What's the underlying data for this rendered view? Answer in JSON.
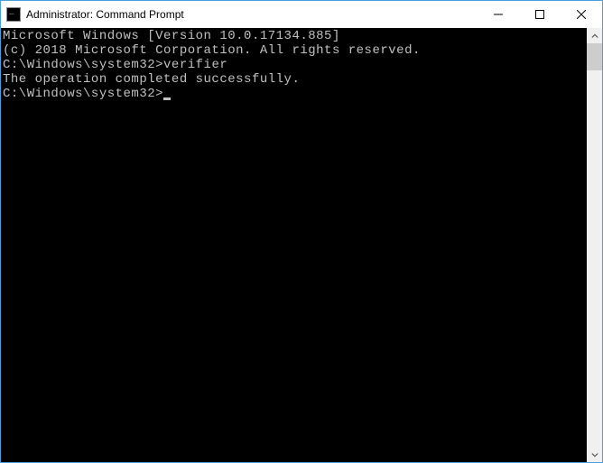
{
  "window": {
    "title": "Administrator: Command Prompt"
  },
  "terminal": {
    "line1": "Microsoft Windows [Version 10.0.17134.885]",
    "line2": "(c) 2018 Microsoft Corporation. All rights reserved.",
    "blank1": "",
    "prompt1_path": "C:\\Windows\\system32>",
    "prompt1_cmd": "verifier",
    "result1": "The operation completed successfully.",
    "blank2": "",
    "prompt2_path": "C:\\Windows\\system32>"
  }
}
